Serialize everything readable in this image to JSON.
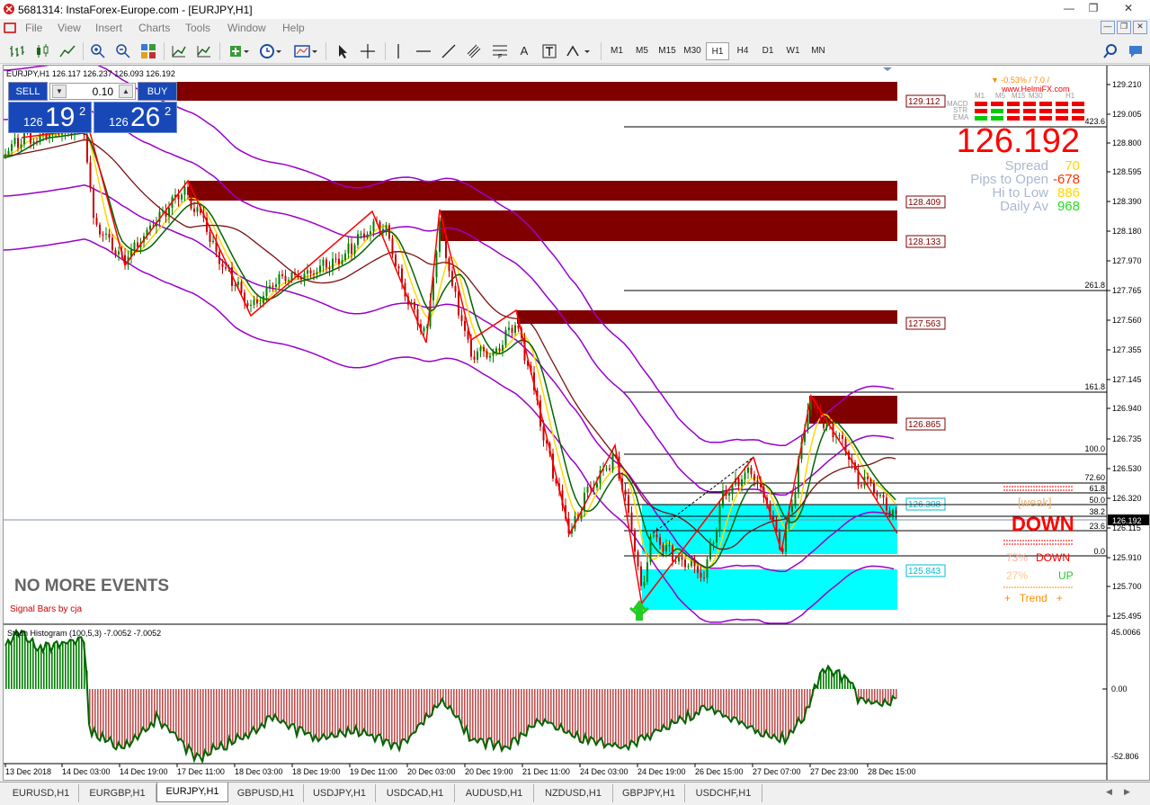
{
  "window": {
    "title": "5681314: InstaForex-Europe.com - [EURJPY,H1]"
  },
  "menu": [
    "File",
    "View",
    "Insert",
    "Charts",
    "Tools",
    "Window",
    "Help"
  ],
  "timeframes": [
    "M1",
    "M5",
    "M15",
    "M30",
    "H1",
    "H4",
    "D1",
    "W1",
    "MN"
  ],
  "active_timeframe": "H1",
  "toolbar_text_tool": "A",
  "chart_header": "EURJPY,H1  126.117 126.237 126.093 126.192",
  "trade_panel": {
    "sell_label": "SELL",
    "buy_label": "BUY",
    "lot": "0.10",
    "sell_small": "126",
    "sell_big": "19",
    "sell_sup": "2",
    "buy_small": "126",
    "buy_big": "26",
    "buy_sup": "2"
  },
  "overlay_text": {
    "no_events": "NO MORE EVENTS",
    "signal_bars": "Signal Bars by cja"
  },
  "dashboard": {
    "change": "▼ -0.53% / 7.0 /",
    "site": "www.HelmiFX.com",
    "tf_labels": [
      "M1",
      "M5",
      "M15",
      "M30",
      "H1"
    ],
    "rows": [
      "MACD",
      "STR",
      "EMA"
    ],
    "price": "126.192",
    "spread_label": "Spread",
    "spread_val": "70",
    "pips_label": "Pips to Open",
    "pips_val": "-678",
    "hilo_label": "Hi to Low",
    "hilo_val": "886",
    "daily_label": "Daily Av",
    "daily_val": "968",
    "weak": "[weak]",
    "direction": "DOWN",
    "pct_down": "73%",
    "down_label": "DOWN",
    "pct_up": "27%",
    "up_label": "UP",
    "trend": "+   Trend   +"
  },
  "zones": {
    "supply": [
      "129.112",
      "128.409",
      "128.133",
      "127.563",
      "126.865"
    ],
    "demand": [
      "126.308",
      "125.843"
    ]
  },
  "fib_levels": [
    "423.6",
    "261.8",
    "161.8",
    "100.0",
    "72.60",
    "61.8",
    "50.0",
    "38.2",
    "23.6",
    "0.0"
  ],
  "price_axis": [
    "129.210",
    "129.005",
    "128.800",
    "128.595",
    "128.390",
    "128.180",
    "127.970",
    "127.765",
    "127.560",
    "127.355",
    "127.145",
    "126.940",
    "126.735",
    "126.530",
    "126.320",
    "126.192",
    "126.115",
    "125.910",
    "125.700",
    "125.495"
  ],
  "current_price": "126.192",
  "time_axis": [
    "13 Dec 2018",
    "14 Dec 03:00",
    "14 Dec 19:00",
    "17 Dec 11:00",
    "18 Dec 03:00",
    "18 Dec 19:00",
    "19 Dec 11:00",
    "20 Dec 03:00",
    "20 Dec 19:00",
    "21 Dec 11:00",
    "24 Dec 03:00",
    "24 Dec 19:00",
    "26 Dec 15:00",
    "27 Dec 07:00",
    "27 Dec 23:00",
    "28 Dec 15:00"
  ],
  "sub_indicator": {
    "label": "Stoch Histogram (100,5,3) -7.0052 -7.0052",
    "axis": [
      "45.0066",
      "0.00",
      "-52.806"
    ]
  },
  "tabs": [
    "EURUSD,H1",
    "EURGBP,H1",
    "EURJPY,H1",
    "GBPUSD,H1",
    "USDJPY,H1",
    "USDCAD,H1",
    "AUDUSD,H1",
    "NZDUSD,H1",
    "GBPJPY,H1",
    "USDCHF,H1"
  ],
  "active_tab": "EURJPY,H1",
  "colors": {
    "supply_zone": "#800000",
    "demand_zone": "#00ffff",
    "bull_candle": "#008000",
    "bear_candle": "#c80000",
    "envelope": "#9900cc",
    "zigzag": "#ff0000",
    "trade_blue": "#1848b8"
  }
}
